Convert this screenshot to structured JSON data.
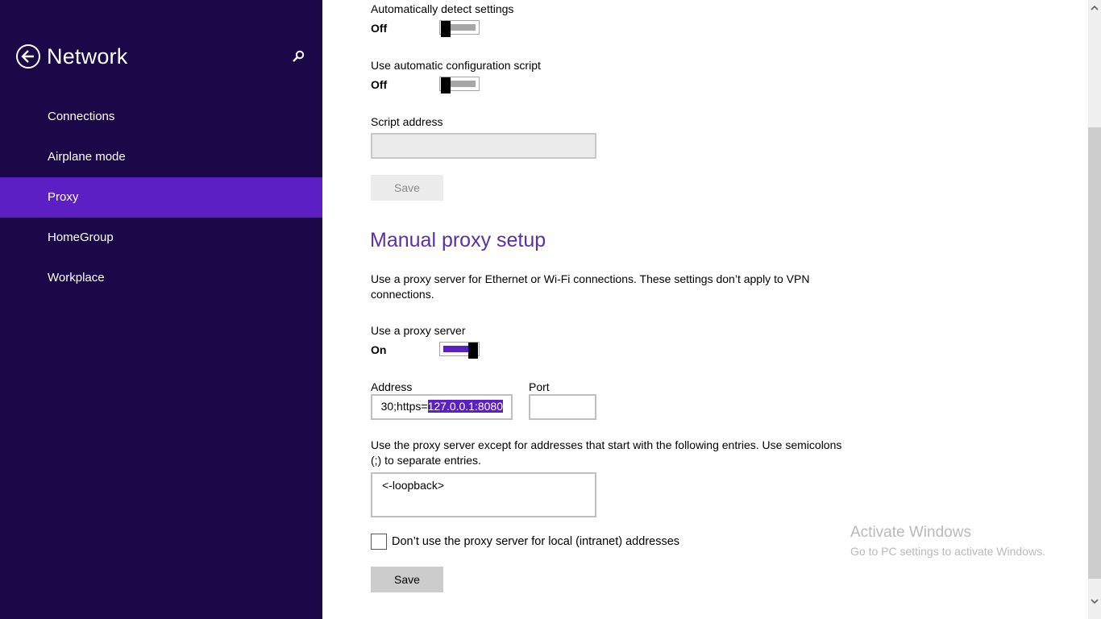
{
  "sidebar": {
    "title": "Network",
    "items": [
      {
        "label": "Connections"
      },
      {
        "label": "Airplane mode"
      },
      {
        "label": "Proxy"
      },
      {
        "label": "HomeGroup"
      },
      {
        "label": "Workplace"
      }
    ],
    "selected_item": "Proxy"
  },
  "auto_setup": {
    "detect_label": "Automatically detect settings",
    "detect_state": "Off",
    "script_label": "Use automatic configuration script",
    "script_state": "Off",
    "script_address_label": "Script address",
    "script_address_value": "",
    "save_label": "Save"
  },
  "manual_setup": {
    "title": "Manual proxy setup",
    "description": "Use a proxy server for Ethernet or Wi-Fi connections. These settings don’t apply to VPN connections.",
    "use_proxy_label": "Use a proxy server",
    "use_proxy_state": "On",
    "address_label": "Address",
    "address_prefix": "30;https=",
    "address_selected": "127.0.0.1:8080",
    "port_label": "Port",
    "port_value": "",
    "exceptions_description": "Use the proxy server except for addresses that start with the following entries. Use semicolons (;) to separate entries.",
    "exceptions_value": "<-loopback>",
    "local_checkbox_label": "Don’t use the proxy server for local (intranet) addresses",
    "local_checkbox_checked": false,
    "save_label": "Save"
  },
  "watermark": {
    "title": "Activate Windows",
    "subtitle": "Go to PC settings to activate Windows."
  },
  "colors": {
    "sidebar_bg": "#1a0849",
    "accent": "#5b1fc4",
    "section_title": "#5b2fa8"
  },
  "icons": {
    "back": "back-arrow-circle-icon",
    "search": "search-icon",
    "scroll_up": "scroll-up-arrow-icon",
    "scroll_down": "scroll-down-arrow-icon"
  }
}
